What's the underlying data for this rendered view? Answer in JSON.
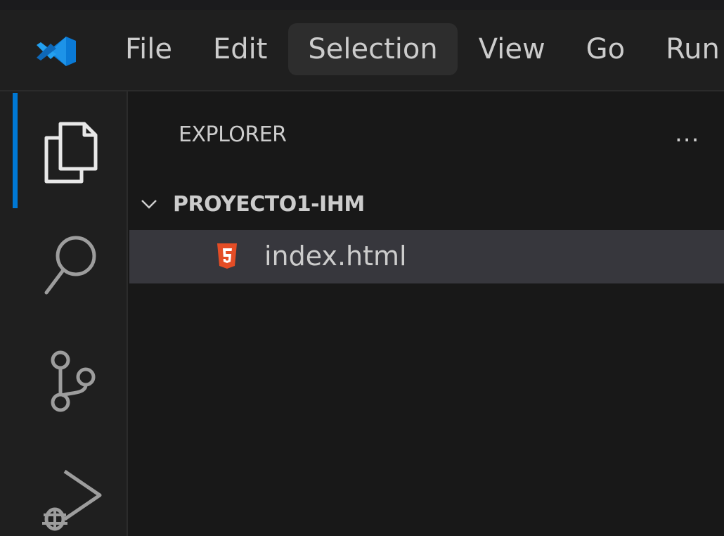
{
  "window": {
    "app_icon": "vscode-logo-icon"
  },
  "menu": {
    "items": [
      {
        "label": "File"
      },
      {
        "label": "Edit"
      },
      {
        "label": "Selection"
      },
      {
        "label": "View"
      },
      {
        "label": "Go"
      },
      {
        "label": "Run"
      }
    ],
    "active_index": 2
  },
  "activity_bar": {
    "items": [
      {
        "icon": "files-icon",
        "active": true
      },
      {
        "icon": "search-icon",
        "active": false
      },
      {
        "icon": "source-control-icon",
        "active": false
      },
      {
        "icon": "run-debug-icon",
        "active": false
      }
    ]
  },
  "sidebar": {
    "title": "EXPLORER",
    "more_label": "...",
    "folder": {
      "name": "PROYECTO1-IHM",
      "expanded": true
    },
    "files": [
      {
        "name": "index.html",
        "icon": "html5-file-icon",
        "selected": true
      }
    ]
  },
  "colors": {
    "accent": "#0078d4",
    "html_icon": "#e44d26",
    "selection_bg": "#37373d",
    "menu_active_bg": "#2d2d2d"
  }
}
